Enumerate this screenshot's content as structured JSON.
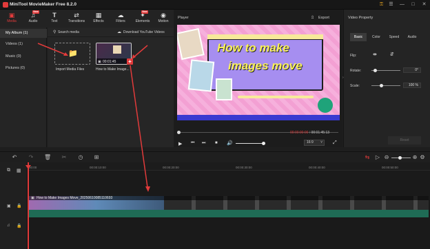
{
  "titlebar": {
    "app_title": "MiniTool MovieMaker Free 8.2.0"
  },
  "toolbar": {
    "items": [
      {
        "label": "Media",
        "icon": "media-icon",
        "badge": ""
      },
      {
        "label": "Audio",
        "icon": "audio-icon",
        "badge": "New"
      },
      {
        "label": "Text",
        "icon": "text-icon",
        "badge": ""
      },
      {
        "label": "Transitions",
        "icon": "transitions-icon",
        "badge": ""
      },
      {
        "label": "Effects",
        "icon": "effects-icon",
        "badge": ""
      },
      {
        "label": "Filters",
        "icon": "filters-icon",
        "badge": ""
      },
      {
        "label": "Elements",
        "icon": "elements-icon",
        "badge": "New"
      },
      {
        "label": "Motion",
        "icon": "motion-icon",
        "badge": ""
      }
    ]
  },
  "media": {
    "sidebar": [
      {
        "label": "My Album (1)"
      },
      {
        "label": "Videos (1)"
      },
      {
        "label": "Music (0)"
      },
      {
        "label": "Pictures (0)"
      }
    ],
    "search_label": "Search media",
    "download_label": "Download YouTube Videos",
    "import_label": "Import Media Files",
    "clip_label": "How to Make Image...",
    "clip_duration": "00:01:45"
  },
  "player": {
    "title": "Player",
    "export_label": "Export",
    "preview_line1": "How to make",
    "preview_line2": "images move",
    "time_current": "00:00:00:00",
    "time_total": "00:01:45:13",
    "aspect": "16:9"
  },
  "props": {
    "title": "Video Property",
    "tabs": [
      "Basic",
      "Color",
      "Speed",
      "Audio"
    ],
    "flip_label": "Flip:",
    "rotate_label": "Rotate:",
    "rotate_value": "0°",
    "scale_label": "Scale:",
    "scale_value": "100 %",
    "reset_label": "Reset"
  },
  "timeline": {
    "ruler_ticks": [
      "00:00",
      "00:00:10:00",
      "00:00:20:00",
      "00:00:30:00",
      "00:00:40:00",
      "00:00:50:00"
    ],
    "clip_title": "How to Make Images Move_20250610085110693"
  },
  "colors": {
    "accent": "#e23b3b",
    "audio_track": "#1f6b55"
  }
}
